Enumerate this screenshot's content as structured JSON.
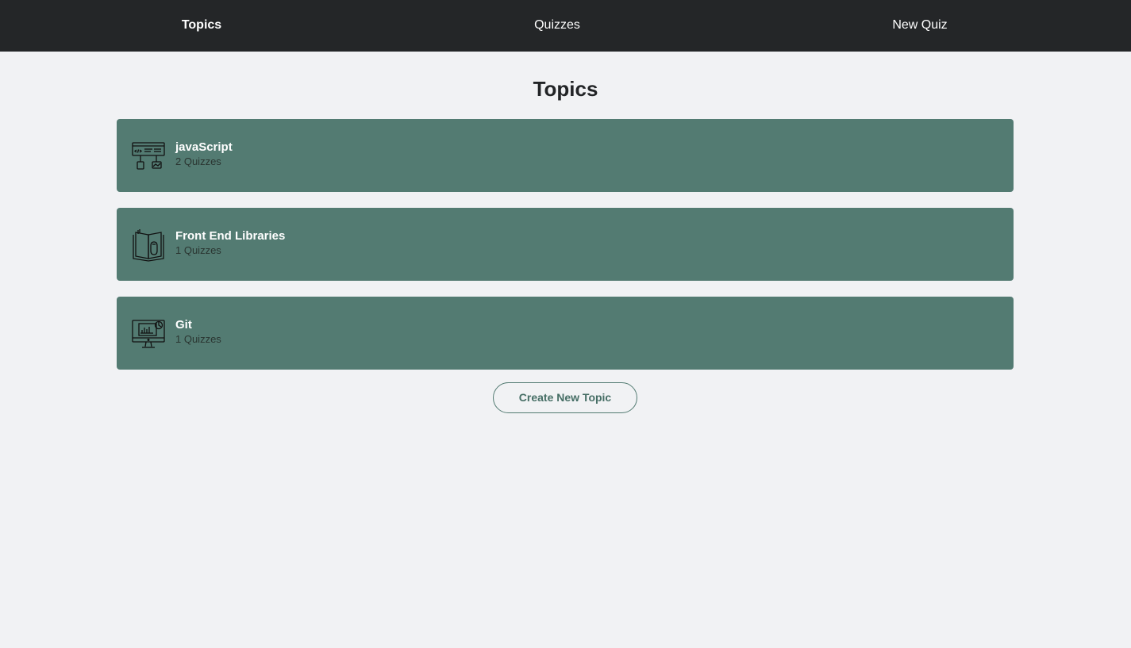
{
  "nav": {
    "items": [
      {
        "label": "Topics"
      },
      {
        "label": "Quizzes"
      },
      {
        "label": "New Quiz"
      }
    ]
  },
  "main": {
    "title": "Topics",
    "topics": [
      {
        "name": "javaScript",
        "count": "2 Quizzes",
        "icon": "code-screen-icon"
      },
      {
        "name": "Front End Libraries",
        "count": "1 Quizzes",
        "icon": "book-icon"
      },
      {
        "name": "Git",
        "count": "1 Quizzes",
        "icon": "monitor-chart-icon"
      }
    ],
    "create_button": "Create New Topic"
  },
  "colors": {
    "navbar": "#242628",
    "background": "#f1f2f4",
    "card": "#537b72",
    "accent": "#537b72"
  }
}
